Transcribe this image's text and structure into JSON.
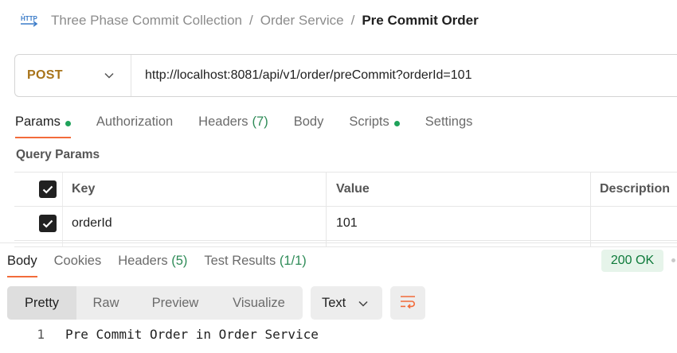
{
  "breadcrumb": {
    "icon": "http-request-icon",
    "icon_text": "HTTP",
    "items": [
      "Three Phase Commit Collection",
      "Order Service"
    ],
    "current": "Pre Commit Order",
    "separator": "/"
  },
  "request": {
    "method": "POST",
    "method_color": "#a8741a",
    "url": "http://localhost:8081/api/v1/order/preCommit?orderId=101"
  },
  "request_tabs": [
    {
      "label": "Params",
      "dot": true,
      "active": true
    },
    {
      "label": "Authorization"
    },
    {
      "label": "Headers",
      "count": "(7)"
    },
    {
      "label": "Body"
    },
    {
      "label": "Scripts",
      "dot": true
    },
    {
      "label": "Settings"
    }
  ],
  "query_params": {
    "title": "Query Params",
    "columns": [
      "Key",
      "Value",
      "Description"
    ],
    "rows": [
      {
        "checked": true,
        "key": "orderId",
        "value": "101",
        "description": ""
      }
    ]
  },
  "response_tabs": [
    {
      "label": "Body",
      "active": true
    },
    {
      "label": "Cookies"
    },
    {
      "label": "Headers",
      "count": "(5)"
    },
    {
      "label": "Test Results",
      "count": "(1/1)"
    }
  ],
  "status": {
    "label": "200 OK",
    "color": "#0e7a3a"
  },
  "view_modes": {
    "options": [
      "Pretty",
      "Raw",
      "Preview",
      "Visualize"
    ],
    "selected": "Pretty"
  },
  "format": {
    "selected": "Text"
  },
  "response_body": {
    "lines": [
      {
        "number": "1",
        "text": "Pre Commit Order in Order Service"
      }
    ]
  },
  "colors": {
    "accent": "#f26b3a",
    "active_dot": "#1fa25a",
    "count": "#2e8b57"
  }
}
